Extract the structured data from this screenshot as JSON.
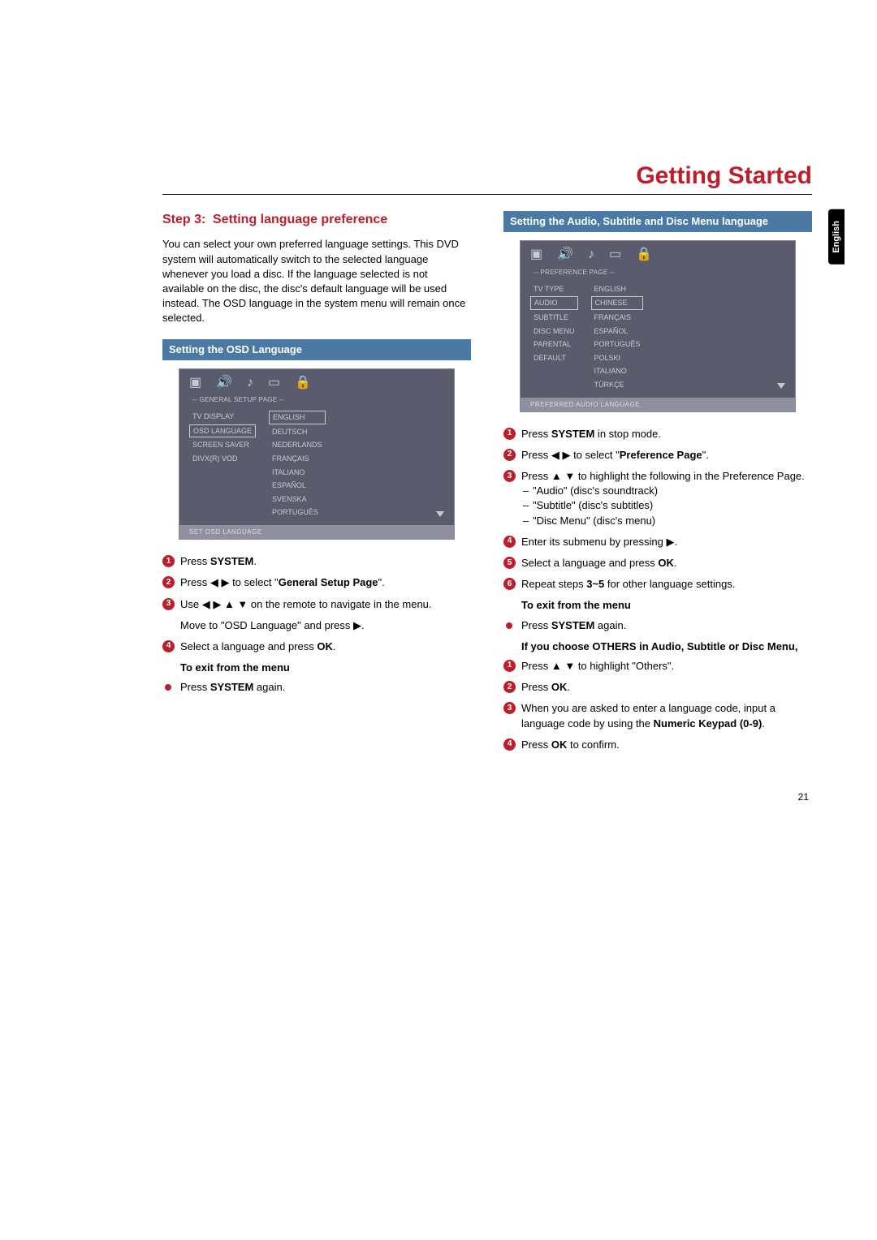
{
  "page_title": "Getting Started",
  "lang_tab": "English",
  "page_number": "21",
  "left": {
    "step_label": "Step 3:",
    "step_title": "Setting language preference",
    "intro": "You can select your own preferred language settings. This DVD system will automatically switch to the selected language whenever you load a disc. If the language selected is not available on the disc, the disc's default language will be used instead. The OSD language in the system menu will remain once selected.",
    "section_bar": "Setting the OSD Language",
    "osd": {
      "subtitle": "-- GENERAL SETUP PAGE --",
      "left_list": [
        "TV DISPLAY",
        "OSD LANGUAGE",
        "SCREEN SAVER",
        "DIVX(R) VOD"
      ],
      "left_highlight": "OSD LANGUAGE",
      "right_list": [
        "ENGLISH",
        "DEUTSCH",
        "NEDERLANDS",
        "FRANÇAIS",
        "ITALIANO",
        "ESPAÑOL",
        "SVENSKA",
        "PORTUGUÊS"
      ],
      "right_highlight": "ENGLISH",
      "footer": "SET OSD LANGUAGE"
    },
    "s1_a": "Press ",
    "s1_b": "SYSTEM",
    "s1_c": ".",
    "s2_a": "Press ",
    "s2_arrows": "◀ ▶",
    "s2_b": " to select \"",
    "s2_c": "General Setup Page",
    "s2_d": "\".",
    "s3_a": "Use ",
    "s3_arrows": "◀ ▶ ▲ ▼",
    "s3_b": " on the remote to navigate in the menu.",
    "s3_note_a": "Move to \"OSD Language\" and press ",
    "s3_note_arrow": "▶",
    "s3_note_b": ".",
    "s4_a": "Select a language and press ",
    "s4_b": "OK",
    "s4_c": ".",
    "exit_head": "To exit from the menu",
    "exit_a": "Press ",
    "exit_b": "SYSTEM",
    "exit_c": " again."
  },
  "right": {
    "section_bar": "Setting the Audio, Subtitle and Disc Menu language",
    "osd": {
      "subtitle": "-- PREFERENCE PAGE --",
      "left_list": [
        "TV TYPE",
        "AUDIO",
        "SUBTITLE",
        "DISC MENU",
        "PARENTAL",
        "DEFAULT"
      ],
      "left_highlight": "AUDIO",
      "right_list": [
        "ENGLISH",
        "CHINESE",
        "FRANÇAIS",
        "ESPAÑOL",
        "PORTUGUÊS",
        "POLSKI",
        "ITALIANO",
        "TÜRKÇE"
      ],
      "right_highlight": "CHINESE",
      "footer": "PREFERRED AUDIO LANGUAGE"
    },
    "s1_a": "Press ",
    "s1_b": "SYSTEM",
    "s1_c": " in stop mode.",
    "s2_a": "Press ",
    "s2_arrows": "◀ ▶",
    "s2_b": " to select \"",
    "s2_c": "Preference Page",
    "s2_d": "\".",
    "s3_a": "Press ",
    "s3_arrows": "▲ ▼",
    "s3_b": " to highlight the following in the Preference Page.",
    "s3_sub1": "\"Audio\" (disc's soundtrack)",
    "s3_sub2": "\"Subtitle\" (disc's subtitles)",
    "s3_sub3": "\"Disc Menu\" (disc's menu)",
    "s4_a": "Enter its submenu by pressing ",
    "s4_arrow": "▶",
    "s4_b": ".",
    "s5_a": "Select a language and press ",
    "s5_b": "OK",
    "s5_c": ".",
    "s6_a": "Repeat steps ",
    "s6_b": "3~5",
    "s6_c": " for other language settings.",
    "exit_head": "To exit from the menu",
    "exit_a": "Press ",
    "exit_b": "SYSTEM",
    "exit_c": " again.",
    "others_head": "If you choose OTHERS in Audio, Subtitle or Disc Menu,",
    "o1_a": "Press ",
    "o1_arrows": "▲ ▼",
    "o1_b": " to highlight \"Others\".",
    "o2_a": "Press ",
    "o2_b": "OK",
    "o2_c": ".",
    "o3_a": "When you are asked to enter a language code, input a language code by using the ",
    "o3_b": "Numeric Keypad (0-9)",
    "o3_c": ".",
    "o4_a": "Press ",
    "o4_b": "OK",
    "o4_c": " to confirm."
  }
}
